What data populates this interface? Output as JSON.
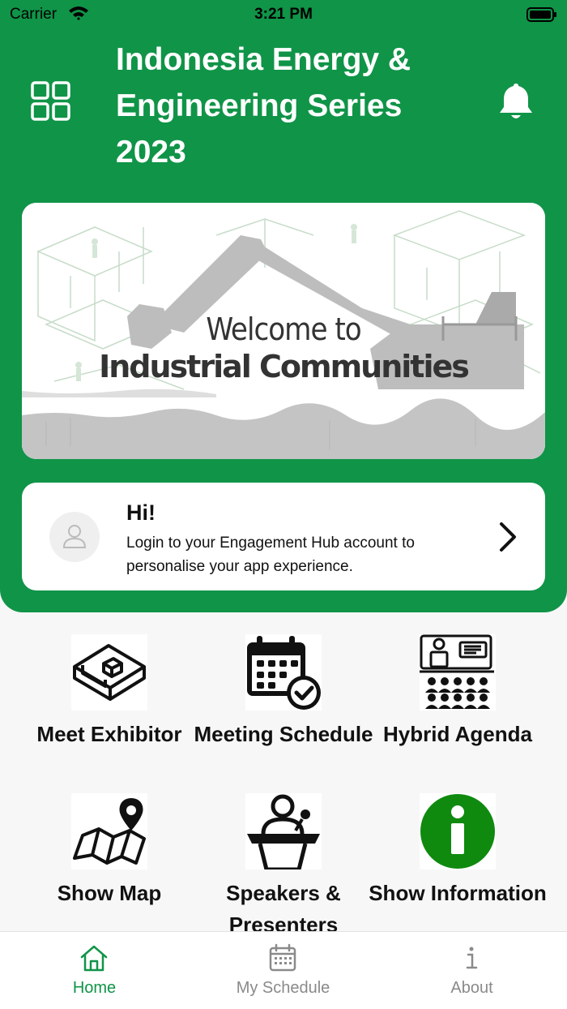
{
  "status_bar": {
    "carrier": "Carrier",
    "time": "3:21 PM"
  },
  "header": {
    "title": "Indonesia Energy & Engineering Series 2023",
    "color": "#109448"
  },
  "banner": {
    "line1": "Welcome to",
    "line2": "Industrial Communities"
  },
  "login_card": {
    "greeting": "Hi!",
    "message": "Login to your Engagement Hub account to personalise your app experience."
  },
  "menu": [
    {
      "label": "Meet Exhibitor",
      "icon": "booth-icon"
    },
    {
      "label": "Meeting Schedule",
      "icon": "calendar-check-icon"
    },
    {
      "label": "Hybrid Agenda",
      "icon": "presentation-audience-icon"
    },
    {
      "label": "Show Map",
      "icon": "map-pin-icon"
    },
    {
      "label": "Speakers & Presenters",
      "icon": "speaker-podium-icon"
    },
    {
      "label": "Show Information",
      "icon": "info-icon"
    }
  ],
  "tabbar": {
    "tabs": [
      {
        "label": "Home",
        "icon": "home-icon",
        "active": true
      },
      {
        "label": "My Schedule",
        "icon": "calendar-icon",
        "active": false
      },
      {
        "label": "About",
        "icon": "info-i-icon",
        "active": false
      }
    ]
  }
}
